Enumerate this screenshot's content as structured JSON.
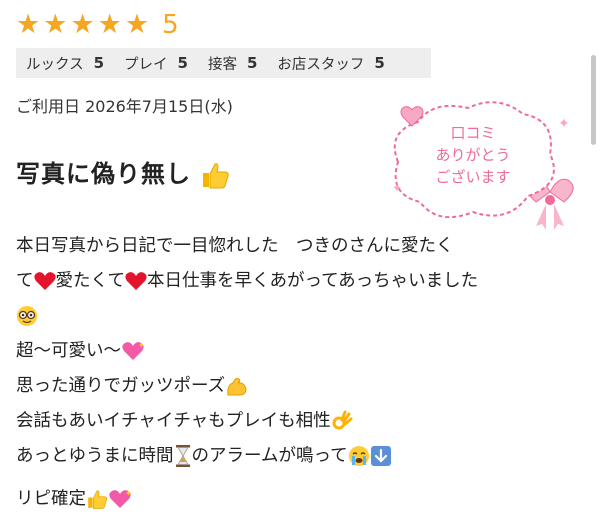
{
  "rating": {
    "overall": "5",
    "stars": 5,
    "star_color": "#f5a623"
  },
  "scores": [
    {
      "label": "ルックス",
      "value": "5"
    },
    {
      "label": "プレイ",
      "value": "5"
    },
    {
      "label": "接客",
      "value": "5"
    },
    {
      "label": "お店スタッフ",
      "value": "5"
    }
  ],
  "date": "ご利用日 2026年7月15日(水)",
  "title": "写真に偽り無し",
  "stamp": {
    "line1": "口コミ",
    "line2": "ありがとう",
    "line3": "ございます",
    "accent": "#f06a9a"
  },
  "body": {
    "l1": "本日写真から日記で一目惚れした　つきのさんに愛たく",
    "l2a": "て",
    "l2b": "愛たくて",
    "l2c": "本日仕事を早くあがってあっちゃいました",
    "l4": "超〜可愛い〜",
    "l5": "思った通りでガッツポーズ",
    "l6": "会話もあいイチャイチャもプレイも相性",
    "l7a": "あっとゆうまに時間",
    "l7b": "のアラームが鳴って"
  },
  "closing": "リピ確定",
  "icons": [
    "star-icon",
    "thumbs-up-icon",
    "heart-icon",
    "nerd-face-icon",
    "sparkling-heart-icon",
    "flexed-biceps-icon",
    "ok-hand-icon",
    "hourglass-icon",
    "crying-face-icon",
    "down-arrow-icon",
    "ribbon-bow-icon"
  ]
}
